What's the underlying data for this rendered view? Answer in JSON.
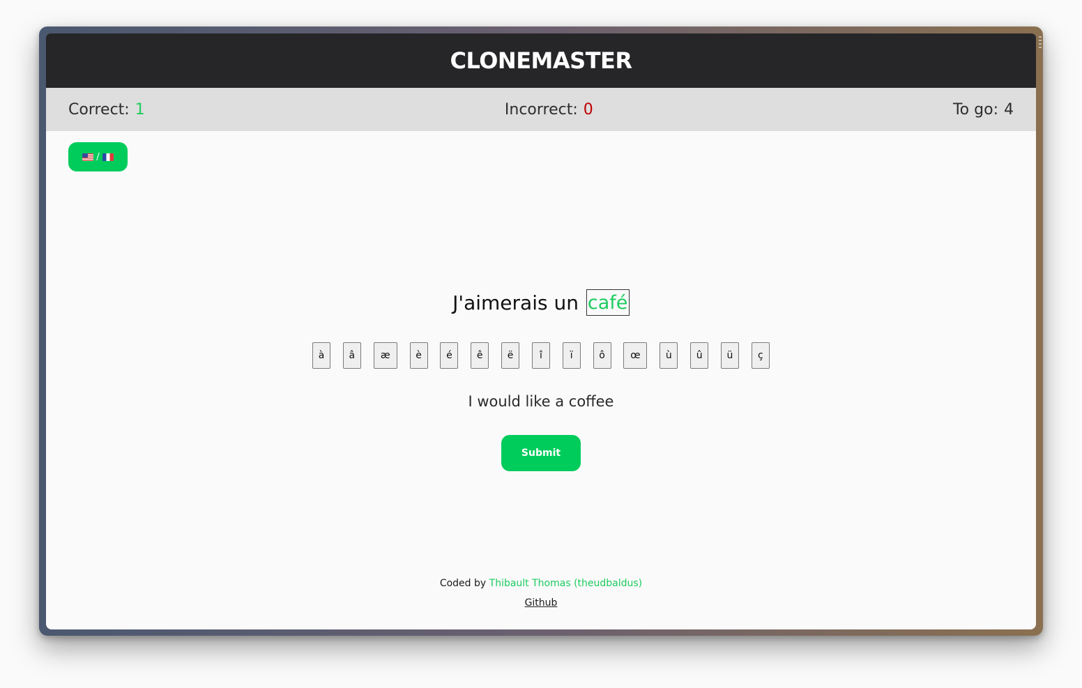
{
  "header": {
    "title": "CLONEMASTER"
  },
  "score": {
    "correct_label": "Correct:",
    "correct_value": "1",
    "incorrect_label": "Incorrect:",
    "incorrect_value": "0",
    "togo_label": "To go:",
    "togo_value": "4"
  },
  "language_toggle": {
    "separator": "/",
    "from_flag": "flag-us-icon",
    "to_flag": "flag-fr-icon"
  },
  "exercise": {
    "prompt": "J'aimerais un ",
    "answer_value": "café",
    "translation": "I would like a coffee"
  },
  "accent_keys": [
    "à",
    "â",
    "æ",
    "è",
    "é",
    "ê",
    "ë",
    "î",
    "ï",
    "ô",
    "œ",
    "ù",
    "û",
    "ü",
    "ç"
  ],
  "submit": {
    "label": "Submit"
  },
  "footer": {
    "coded_by": "Coded by ",
    "author": "Thibault Thomas (theudbaldus)",
    "github": "Github"
  },
  "colors": {
    "accent": "#00cc5c",
    "correct": "#1ecb5f",
    "incorrect": "#c00000",
    "header_bg": "#262628"
  }
}
